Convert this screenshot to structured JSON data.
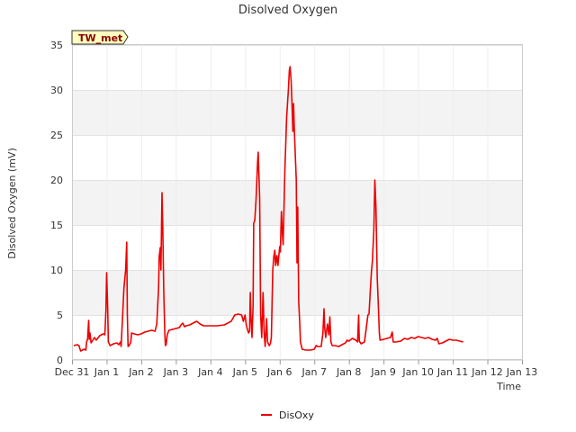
{
  "chart_data": {
    "type": "line",
    "title": "Disolved Oxygen",
    "xlabel": "Time",
    "ylabel": "Disolved Oxygen (mV)",
    "ylim": [
      0,
      35
    ],
    "yticks": [
      0,
      5,
      10,
      15,
      20,
      25,
      30,
      35
    ],
    "xlim": [
      0,
      13
    ],
    "xtick_labels": [
      "Dec 31",
      "Jan 1",
      "Jan 2",
      "Jan 3",
      "Jan 4",
      "Jan 5",
      "Jan 6",
      "Jan 7",
      "Jan 8",
      "Jan 9",
      "Jan 10",
      "Jan 11",
      "Jan 12",
      "Jan 13"
    ],
    "grid": true,
    "legend_position": "bottom-center",
    "station_badge": "TW_met",
    "series": [
      {
        "name": "DisOxy",
        "color": "#ee0000",
        "points": [
          [
            0.05,
            1.6
          ],
          [
            0.15,
            1.7
          ],
          [
            0.2,
            1.6
          ],
          [
            0.25,
            1.0
          ],
          [
            0.35,
            1.2
          ],
          [
            0.4,
            1.1
          ],
          [
            0.42,
            2.0
          ],
          [
            0.45,
            2.3
          ],
          [
            0.48,
            4.4
          ],
          [
            0.5,
            2.3
          ],
          [
            0.52,
            3.0
          ],
          [
            0.55,
            1.9
          ],
          [
            0.6,
            2.2
          ],
          [
            0.65,
            2.5
          ],
          [
            0.7,
            2.2
          ],
          [
            0.8,
            2.7
          ],
          [
            0.9,
            2.9
          ],
          [
            0.95,
            2.8
          ],
          [
            0.98,
            5.5
          ],
          [
            1.0,
            9.7
          ],
          [
            1.03,
            6.0
          ],
          [
            1.05,
            2.0
          ],
          [
            1.1,
            1.6
          ],
          [
            1.2,
            1.8
          ],
          [
            1.3,
            1.9
          ],
          [
            1.35,
            1.7
          ],
          [
            1.4,
            2.0
          ],
          [
            1.42,
            1.5
          ],
          [
            1.45,
            4.0
          ],
          [
            1.5,
            8.0
          ],
          [
            1.55,
            10.0
          ],
          [
            1.58,
            13.1
          ],
          [
            1.6,
            5.0
          ],
          [
            1.62,
            1.5
          ],
          [
            1.65,
            1.6
          ],
          [
            1.7,
            2.0
          ],
          [
            1.72,
            3.0
          ],
          [
            1.8,
            2.9
          ],
          [
            1.9,
            2.8
          ],
          [
            2.0,
            2.9
          ],
          [
            2.1,
            3.1
          ],
          [
            2.2,
            3.2
          ],
          [
            2.3,
            3.3
          ],
          [
            2.4,
            3.2
          ],
          [
            2.45,
            4.0
          ],
          [
            2.5,
            8.0
          ],
          [
            2.52,
            11.5
          ],
          [
            2.55,
            12.5
          ],
          [
            2.57,
            10.0
          ],
          [
            2.6,
            18.6
          ],
          [
            2.62,
            15.0
          ],
          [
            2.65,
            8.0
          ],
          [
            2.68,
            3.0
          ],
          [
            2.7,
            1.6
          ],
          [
            2.72,
            1.7
          ],
          [
            2.75,
            2.8
          ],
          [
            2.8,
            3.3
          ],
          [
            2.9,
            3.4
          ],
          [
            3.0,
            3.5
          ],
          [
            3.1,
            3.6
          ],
          [
            3.15,
            3.9
          ],
          [
            3.2,
            4.1
          ],
          [
            3.25,
            3.7
          ],
          [
            3.3,
            3.8
          ],
          [
            3.4,
            3.9
          ],
          [
            3.5,
            4.1
          ],
          [
            3.6,
            4.3
          ],
          [
            3.7,
            4.0
          ],
          [
            3.8,
            3.8
          ],
          [
            4.0,
            3.8
          ],
          [
            4.2,
            3.8
          ],
          [
            4.4,
            3.9
          ],
          [
            4.5,
            4.1
          ],
          [
            4.6,
            4.3
          ],
          [
            4.7,
            5.0
          ],
          [
            4.8,
            5.1
          ],
          [
            4.9,
            5.0
          ],
          [
            4.95,
            4.3
          ],
          [
            5.0,
            5.0
          ],
          [
            5.03,
            4.0
          ],
          [
            5.06,
            3.5
          ],
          [
            5.1,
            3.0
          ],
          [
            5.13,
            3.2
          ],
          [
            5.15,
            7.5
          ],
          [
            5.17,
            5.0
          ],
          [
            5.2,
            2.5
          ],
          [
            5.23,
            6.0
          ],
          [
            5.25,
            15.2
          ],
          [
            5.28,
            15.5
          ],
          [
            5.32,
            18.0
          ],
          [
            5.36,
            22.0
          ],
          [
            5.38,
            23.1
          ],
          [
            5.42,
            18.0
          ],
          [
            5.45,
            5.0
          ],
          [
            5.48,
            2.5
          ],
          [
            5.52,
            7.5
          ],
          [
            5.55,
            3.0
          ],
          [
            5.58,
            1.5
          ],
          [
            5.62,
            4.6
          ],
          [
            5.65,
            2.0
          ],
          [
            5.7,
            1.6
          ],
          [
            5.73,
            1.8
          ],
          [
            5.76,
            2.5
          ],
          [
            5.8,
            10.0
          ],
          [
            5.83,
            11.5
          ],
          [
            5.86,
            12.2
          ],
          [
            5.88,
            10.5
          ],
          [
            5.92,
            11.6
          ],
          [
            5.95,
            10.5
          ],
          [
            6.0,
            12.6
          ],
          [
            6.02,
            12.0
          ],
          [
            6.05,
            16.5
          ],
          [
            6.08,
            14.0
          ],
          [
            6.1,
            12.8
          ],
          [
            6.15,
            21.0
          ],
          [
            6.2,
            27.0
          ],
          [
            6.25,
            30.0
          ],
          [
            6.28,
            32.2
          ],
          [
            6.3,
            32.6
          ],
          [
            6.33,
            31.0
          ],
          [
            6.36,
            28.0
          ],
          [
            6.38,
            25.4
          ],
          [
            6.4,
            28.5
          ],
          [
            6.42,
            26.0
          ],
          [
            6.45,
            22.8
          ],
          [
            6.48,
            20.0
          ],
          [
            6.5,
            10.8
          ],
          [
            6.52,
            17.0
          ],
          [
            6.55,
            6.5
          ],
          [
            6.58,
            4.0
          ],
          [
            6.6,
            2.0
          ],
          [
            6.65,
            1.2
          ],
          [
            6.75,
            1.1
          ],
          [
            6.9,
            1.1
          ],
          [
            7.0,
            1.2
          ],
          [
            7.05,
            1.6
          ],
          [
            7.1,
            1.5
          ],
          [
            7.2,
            1.5
          ],
          [
            7.25,
            3.0
          ],
          [
            7.28,
            5.7
          ],
          [
            7.3,
            3.5
          ],
          [
            7.33,
            2.5
          ],
          [
            7.38,
            4.0
          ],
          [
            7.42,
            2.8
          ],
          [
            7.45,
            4.8
          ],
          [
            7.48,
            2.0
          ],
          [
            7.52,
            1.6
          ],
          [
            7.6,
            1.6
          ],
          [
            7.7,
            1.5
          ],
          [
            7.8,
            1.7
          ],
          [
            7.9,
            1.9
          ],
          [
            7.95,
            2.2
          ],
          [
            8.0,
            2.1
          ],
          [
            8.1,
            2.4
          ],
          [
            8.2,
            2.2
          ],
          [
            8.25,
            2.0
          ],
          [
            8.28,
            5.0
          ],
          [
            8.3,
            2.1
          ],
          [
            8.35,
            1.8
          ],
          [
            8.45,
            2.0
          ],
          [
            8.5,
            3.5
          ],
          [
            8.55,
            5.0
          ],
          [
            8.58,
            5.1
          ],
          [
            8.62,
            7.8
          ],
          [
            8.65,
            9.8
          ],
          [
            8.68,
            11.0
          ],
          [
            8.72,
            14.5
          ],
          [
            8.75,
            20.0
          ],
          [
            8.78,
            17.0
          ],
          [
            8.82,
            9.0
          ],
          [
            8.85,
            6.0
          ],
          [
            8.88,
            3.0
          ],
          [
            8.9,
            2.2
          ],
          [
            9.0,
            2.3
          ],
          [
            9.1,
            2.4
          ],
          [
            9.2,
            2.5
          ],
          [
            9.25,
            3.1
          ],
          [
            9.28,
            2.0
          ],
          [
            9.35,
            2.0
          ],
          [
            9.5,
            2.1
          ],
          [
            9.6,
            2.4
          ],
          [
            9.7,
            2.3
          ],
          [
            9.8,
            2.5
          ],
          [
            9.9,
            2.4
          ],
          [
            10.0,
            2.6
          ],
          [
            10.1,
            2.5
          ],
          [
            10.2,
            2.4
          ],
          [
            10.3,
            2.5
          ],
          [
            10.4,
            2.3
          ],
          [
            10.5,
            2.2
          ],
          [
            10.55,
            2.4
          ],
          [
            10.6,
            1.8
          ],
          [
            10.7,
            1.9
          ],
          [
            10.8,
            2.1
          ],
          [
            10.9,
            2.3
          ],
          [
            11.0,
            2.2
          ],
          [
            11.1,
            2.2
          ],
          [
            11.2,
            2.1
          ],
          [
            11.3,
            2.0
          ]
        ]
      }
    ]
  }
}
